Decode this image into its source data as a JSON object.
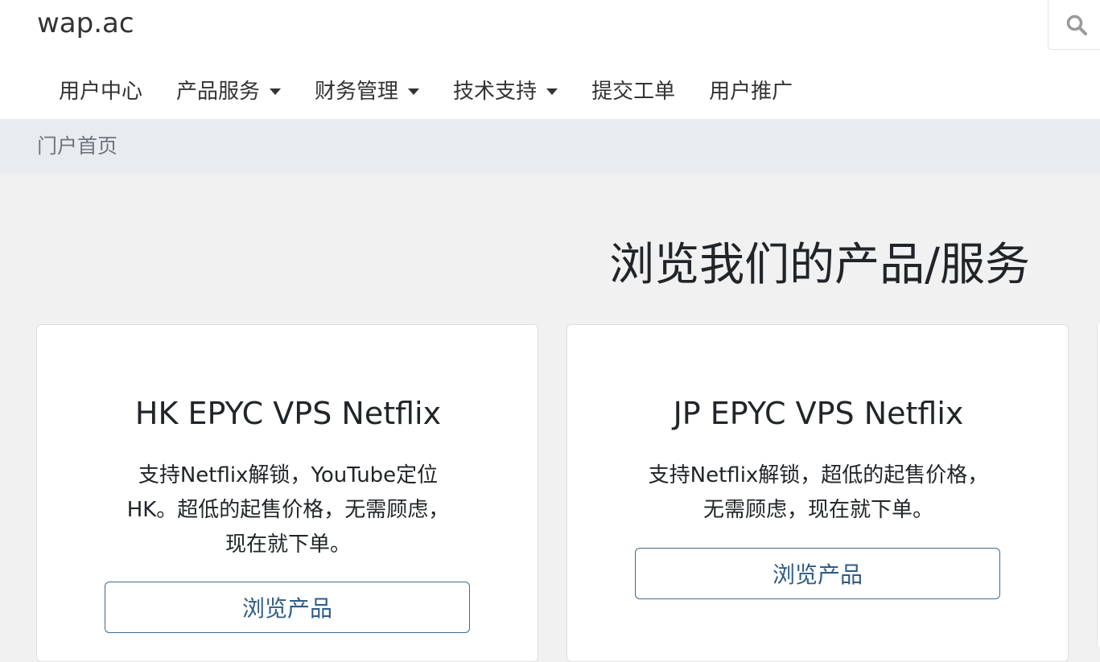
{
  "header": {
    "brand": "wap.ac",
    "search_icon": "search-icon"
  },
  "nav": {
    "items": [
      {
        "label": "用户中心",
        "has_dropdown": false
      },
      {
        "label": "产品服务",
        "has_dropdown": true
      },
      {
        "label": "财务管理",
        "has_dropdown": true
      },
      {
        "label": "技术支持",
        "has_dropdown": true
      },
      {
        "label": "提交工单",
        "has_dropdown": false
      },
      {
        "label": "用户推广",
        "has_dropdown": false
      }
    ]
  },
  "breadcrumb": {
    "current": "门户首页"
  },
  "main": {
    "title": "浏览我们的产品/服务",
    "products": [
      {
        "name": "HK EPYC VPS Netflix",
        "description_lines": [
          "支持Netflix解锁，YouTube定位",
          "HK。超低的起售价格，无需顾虑，",
          "现在就下单。"
        ],
        "button_label": "浏览产品"
      },
      {
        "name": "JP EPYC VPS Netflix",
        "description_lines": [
          "支持Netflix解锁，超低的起售价格，",
          "无需顾虑，现在就下单。"
        ],
        "button_label": "浏览产品"
      }
    ]
  },
  "colors": {
    "accent": "#2f5c85",
    "breadcrumb_bg": "#e9ecef",
    "page_bg": "#f1f1f1"
  }
}
